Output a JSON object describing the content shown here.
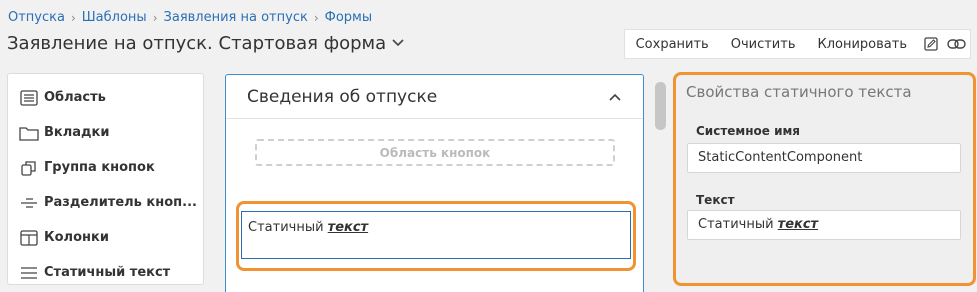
{
  "breadcrumb": {
    "items": [
      "Отпуска",
      "Шаблоны",
      "Заявления на отпуск",
      "Формы"
    ]
  },
  "page": {
    "title": "Заявление на отпуск. Стартовая форма"
  },
  "toolbar": {
    "save_label": "Сохранить",
    "clear_label": "Очистить",
    "clone_label": "Клонировать",
    "edit_icon": "edit-icon",
    "link_icon": "link-icon"
  },
  "palette": {
    "items": [
      {
        "label": "Область",
        "icon": "list-icon"
      },
      {
        "label": "Вкладки",
        "icon": "folder-icon"
      },
      {
        "label": "Группа кнопок",
        "icon": "copy-icon"
      },
      {
        "label": "Разделитель кноп...",
        "icon": "divider-icon"
      },
      {
        "label": "Колонки",
        "icon": "columns-icon"
      },
      {
        "label": "Статичный текст",
        "icon": "text-lines-icon"
      }
    ]
  },
  "canvas": {
    "section_title": "Сведения об отпуске",
    "button_area_label": "Область кнопок",
    "static_text_plain": "Статичный",
    "static_text_emph": "текст"
  },
  "props": {
    "title": "Свойства статичного текста",
    "system_name_label": "Системное имя",
    "system_name_value": "StaticContentComponent",
    "text_label": "Текст",
    "text_value_plain": "Статичный",
    "text_value_emph": "текст"
  },
  "colors": {
    "link": "#2a6fb5",
    "highlight": "#ef9333",
    "selection_border": "#3d8fd1"
  }
}
